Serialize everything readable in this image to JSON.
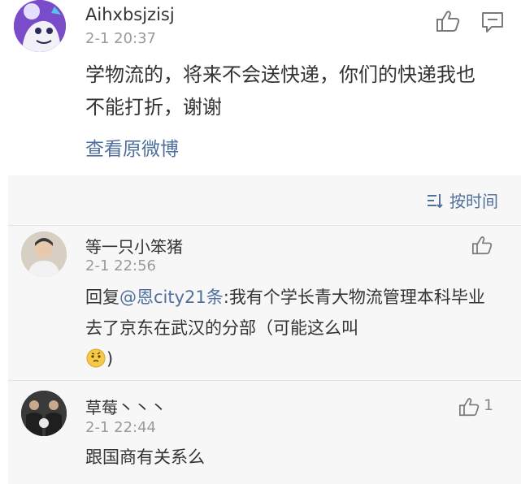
{
  "post": {
    "username": "Aihxbsjzisj",
    "time": "2-1 20:37",
    "body": "学物流的，将来不会送快递，你们的快递我也不能打折，谢谢",
    "view_original": "查看原微博",
    "icons": {
      "like": "thumbs-up-icon",
      "comment": "comment-icon",
      "avatar": "cartoon-avatar"
    }
  },
  "sort": {
    "label": "按时间",
    "icon": "sort-icon"
  },
  "comments": [
    {
      "username": "等一只小笨猪",
      "time": "2-1 22:56",
      "reply_prefix": "回复",
      "mention": "@恩city21条",
      "text": ":我有个学长青大物流管理本科毕业去了京东在武汉的分部（可能这么叫",
      "emoji_icon": "thinking-emoji-icon",
      "text_end": ")"
    },
    {
      "username": "草莓丶丶丶",
      "time": "2-1 22:44",
      "text": "跟国商有关系么",
      "likes": "1"
    }
  ],
  "colors": {
    "link": "#4f6f9d",
    "text": "#333333",
    "muted": "#9a9a9a",
    "comment_bg": "#f7f7f7"
  }
}
